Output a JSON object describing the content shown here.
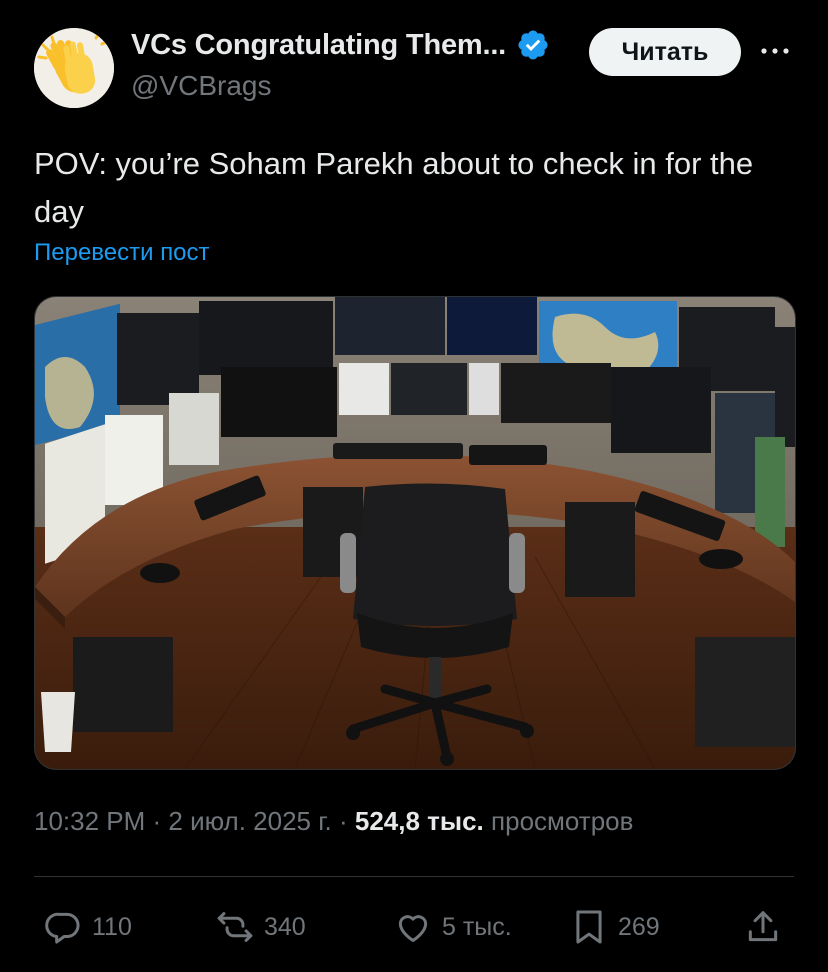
{
  "author": {
    "display_name": "VCs Congratulating Them...",
    "handle": "@VCBrags",
    "avatar_icon": "clapping-hands-icon",
    "verified_color": "#1d9bf0"
  },
  "follow_button": {
    "label": "Читать"
  },
  "post": {
    "text": "POV: you’re Soham Parekh about to check in for the day",
    "translate_label": "Перевести пост"
  },
  "meta": {
    "time": "10:32 PM",
    "separator": " · ",
    "date": "2 июл. 2025 г.",
    "views_count": "524,8 тыс.",
    "views_label": "просмотров"
  },
  "actions": {
    "replies": "110",
    "reposts": "340",
    "likes": "5 тыс.",
    "bookmarks": "269"
  },
  "colors": {
    "background": "#000000",
    "text": "#e7e9ea",
    "muted": "#71767b",
    "accent": "#1d9bf0"
  }
}
